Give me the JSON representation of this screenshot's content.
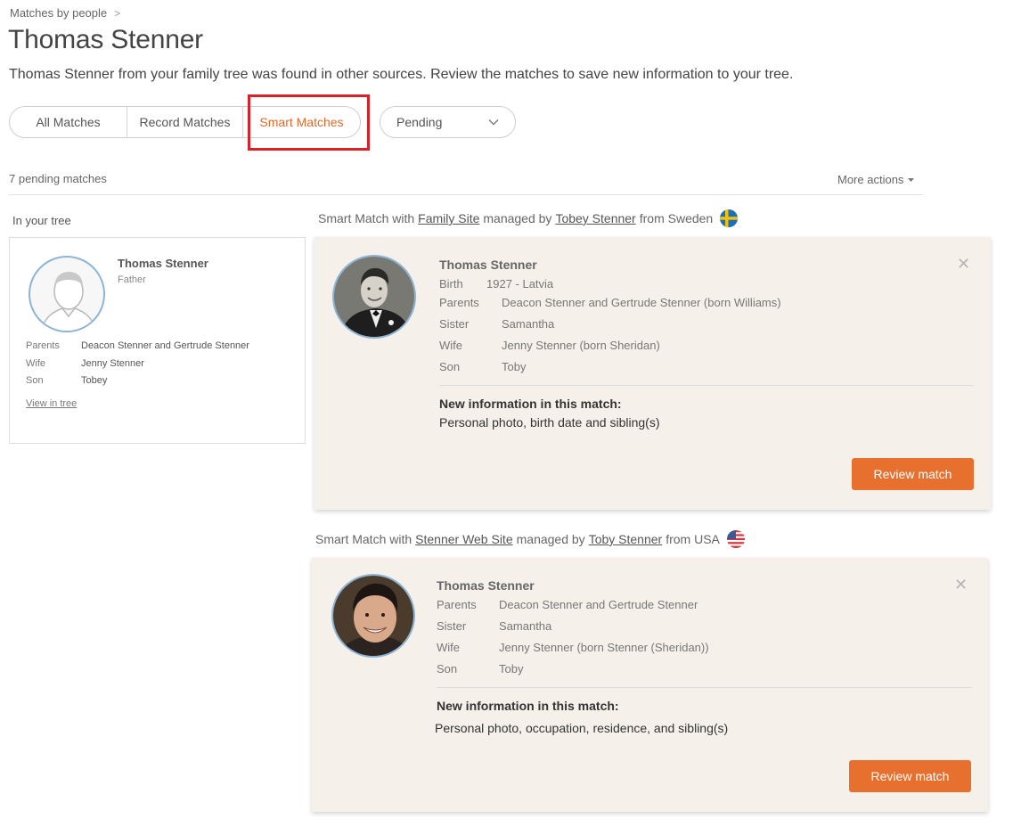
{
  "breadcrumb": {
    "label": "Matches by people",
    "separator": ">"
  },
  "page_title": "Thomas Stenner",
  "subtitle": "Thomas Stenner from your family tree was found in other sources. Review the matches to save new information to your tree.",
  "tabs": [
    {
      "label": "All Matches",
      "active": false
    },
    {
      "label": "Record Matches",
      "active": false
    },
    {
      "label": "Smart Matches",
      "active": true
    }
  ],
  "filter": {
    "selected": "Pending"
  },
  "pending_count": "7 pending matches",
  "more_actions": "More actions",
  "in_tree_label": "In your tree",
  "tree_card": {
    "name": "Thomas Stenner",
    "role": "Father",
    "relations": [
      {
        "key": "Parents",
        "value": "Deacon Stenner and Gertrude Stenner"
      },
      {
        "key": "Wife",
        "value": "Jenny Stenner"
      },
      {
        "key": "Son",
        "value": "Tobey"
      }
    ],
    "view_link": "View in tree"
  },
  "matches": [
    {
      "header_prefix": "Smart Match with",
      "site": "Family Site",
      "managed_by_text": "managed by",
      "manager": "Tobey Stenner",
      "from_text": "from Sweden",
      "name": "Thomas Stenner",
      "rows": [
        {
          "key": "Birth",
          "value": "1927 - Latvia"
        },
        {
          "key": "Parents",
          "value": "Deacon Stenner and Gertrude Stenner (born Williams)"
        },
        {
          "key": "Sister",
          "value": "Samantha"
        },
        {
          "key": "Wife",
          "value": "Jenny Stenner (born Sheridan)"
        },
        {
          "key": "Son",
          "value": "Toby"
        }
      ],
      "new_info_title": "New information in this match:",
      "new_info": "Personal photo, birth date and sibling(s)",
      "button": "Review match"
    },
    {
      "header_prefix": "Smart Match with",
      "site": "Stenner Web Site",
      "managed_by_text": "managed by",
      "manager": "Toby Stenner",
      "from_text": "from USA",
      "name": "Thomas Stenner",
      "rows": [
        {
          "key": "Parents",
          "value": "Deacon Stenner and Gertrude Stenner"
        },
        {
          "key": "Sister",
          "value": "Samantha"
        },
        {
          "key": "Wife",
          "value": "Jenny Stenner (born Stenner (Sheridan))"
        },
        {
          "key": "Son",
          "value": "Toby"
        }
      ],
      "new_info_title": "New information in this match:",
      "new_info": "Personal photo, occupation, residence, and sibling(s)",
      "button": "Review match"
    }
  ],
  "colors": {
    "accent": "#e8702e",
    "active_tab": "#e06a2a",
    "highlight": "#d9212a",
    "card_bg": "#f5f1ea",
    "avatar_ring": "#8cb4d6"
  },
  "icons": {
    "close": "close-icon",
    "dropdown": "chevron-down-icon",
    "more": "caret-down-icon",
    "flag_sweden": "sweden-flag-icon",
    "flag_usa": "usa-flag-icon"
  }
}
